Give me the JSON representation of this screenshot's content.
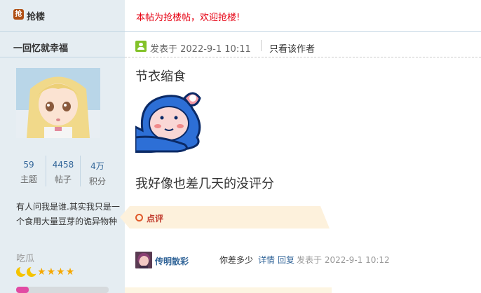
{
  "sidebar": {
    "qianlou_icon_char": "抢",
    "qianlou_label": "抢楼",
    "author_name": "一回忆就幸福",
    "stats": [
      {
        "value": "59",
        "label": "主题"
      },
      {
        "value": "4458",
        "label": "帖子"
      },
      {
        "value": "4万",
        "label": "积分"
      }
    ],
    "signature": "有人问我是谁.其实我只是一个食用大量豆芽的诡异物种",
    "rank": "吃瓜",
    "star_icons": [
      "moon-icon",
      "moon-icon",
      "star-icon",
      "star-icon",
      "star-icon",
      "star-icon"
    ],
    "level_progress": 0.14,
    "colors": {
      "progress": "#e14aa3",
      "bg": "#e5edf2"
    }
  },
  "post": {
    "notice": "本帖为抢楼帖，欢迎抢楼!",
    "posted_at": "发表于 2022-9-1 10:11",
    "only_author": "只看该作者",
    "line1": "节衣缩食",
    "line2": "我好像也差几天的没评分"
  },
  "comments": {
    "header": "点评",
    "items": [
      {
        "user": "传明散彩",
        "text": "你差多少",
        "detail_link": "详情",
        "reply_link": "回复",
        "time": "发表于 2022-9-1 10:12"
      }
    ]
  }
}
